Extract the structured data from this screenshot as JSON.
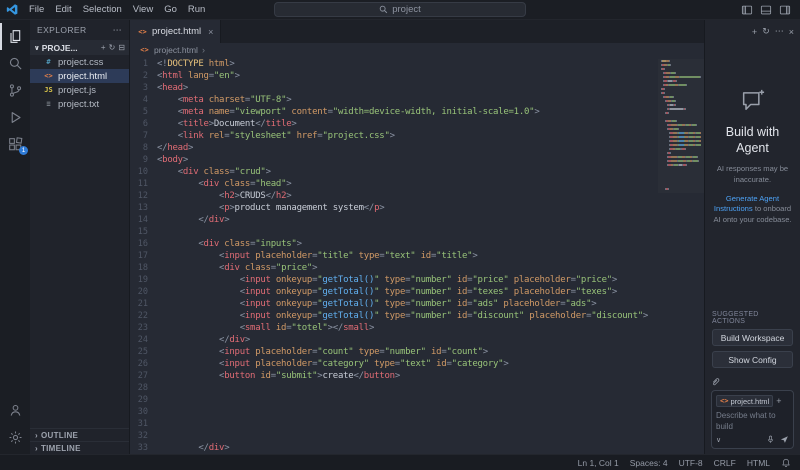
{
  "titlebar": {
    "menus": [
      "File",
      "Edit",
      "Selection",
      "View",
      "Go",
      "Run"
    ],
    "search_text": "project"
  },
  "activity": {
    "extensions_badge": "1"
  },
  "sidebar": {
    "title": "EXPLORER",
    "folder_name": "PROJE...",
    "files": [
      {
        "name": "project.css",
        "type": "css",
        "glyph": "#",
        "color": "#519aba",
        "selected": false
      },
      {
        "name": "project.html",
        "type": "html",
        "glyph": "<>",
        "color": "#e8824a",
        "selected": true
      },
      {
        "name": "project.js",
        "type": "js",
        "glyph": "JS",
        "color": "#d8c44a",
        "selected": false
      },
      {
        "name": "project.txt",
        "type": "txt",
        "glyph": "≡",
        "color": "#8a9199",
        "selected": false
      }
    ],
    "outline_label": "OUTLINE",
    "timeline_label": "TIMELINE"
  },
  "editor": {
    "tab_name": "project.html",
    "breadcrumb": "project.html",
    "syntax_colors": {
      "t": "#e06c75",
      "a": "#d19a66",
      "s": "#98c379",
      "p": "#8b93a3",
      "x": "#c7ccd6",
      "j": "#61afef",
      "d": "#e5c07b",
      "w": "transparent"
    },
    "lines": [
      [
        [
          "p",
          "<!"
        ],
        [
          "d",
          "DOCTYPE"
        ],
        [
          "a",
          " html"
        ],
        [
          "p",
          ">"
        ]
      ],
      [
        [
          "p",
          "<"
        ],
        [
          "t",
          "html"
        ],
        [
          "a",
          " lang"
        ],
        [
          "p",
          "="
        ],
        [
          "s",
          "\"en\""
        ],
        [
          "p",
          ">"
        ]
      ],
      [
        [
          "p",
          "<"
        ],
        [
          "t",
          "head"
        ],
        [
          "p",
          ">"
        ]
      ],
      [
        [
          "w",
          "    "
        ],
        [
          "p",
          "<"
        ],
        [
          "t",
          "meta"
        ],
        [
          "a",
          " charset"
        ],
        [
          "p",
          "="
        ],
        [
          "s",
          "\"UTF-8\""
        ],
        [
          "p",
          ">"
        ]
      ],
      [
        [
          "w",
          "    "
        ],
        [
          "p",
          "<"
        ],
        [
          "t",
          "meta"
        ],
        [
          "a",
          " name"
        ],
        [
          "p",
          "="
        ],
        [
          "s",
          "\"viewport\""
        ],
        [
          "a",
          " content"
        ],
        [
          "p",
          "="
        ],
        [
          "s",
          "\"width=device-width, initial-scale=1.0\""
        ],
        [
          "p",
          ">"
        ]
      ],
      [
        [
          "w",
          "    "
        ],
        [
          "p",
          "<"
        ],
        [
          "t",
          "title"
        ],
        [
          "p",
          ">"
        ],
        [
          "x",
          "Document"
        ],
        [
          "p",
          "</"
        ],
        [
          "t",
          "title"
        ],
        [
          "p",
          ">"
        ]
      ],
      [
        [
          "w",
          "    "
        ],
        [
          "p",
          "<"
        ],
        [
          "t",
          "link"
        ],
        [
          "a",
          " rel"
        ],
        [
          "p",
          "="
        ],
        [
          "s",
          "\"stylesheet\""
        ],
        [
          "a",
          " href"
        ],
        [
          "p",
          "="
        ],
        [
          "s",
          "\"project.css\""
        ],
        [
          "p",
          ">"
        ]
      ],
      [
        [
          "p",
          "</"
        ],
        [
          "t",
          "head"
        ],
        [
          "p",
          ">"
        ]
      ],
      [
        [
          "p",
          "<"
        ],
        [
          "t",
          "body"
        ],
        [
          "p",
          ">"
        ]
      ],
      [
        [
          "w",
          "    "
        ],
        [
          "p",
          "<"
        ],
        [
          "t",
          "div"
        ],
        [
          "a",
          " class"
        ],
        [
          "p",
          "="
        ],
        [
          "s",
          "\"crud\""
        ],
        [
          "p",
          ">"
        ]
      ],
      [
        [
          "w",
          "        "
        ],
        [
          "p",
          "<"
        ],
        [
          "t",
          "div"
        ],
        [
          "a",
          " class"
        ],
        [
          "p",
          "="
        ],
        [
          "s",
          "\"head\""
        ],
        [
          "p",
          ">"
        ]
      ],
      [
        [
          "w",
          "            "
        ],
        [
          "p",
          "<"
        ],
        [
          "t",
          "h2"
        ],
        [
          "p",
          ">"
        ],
        [
          "x",
          "CRUDS"
        ],
        [
          "p",
          "</"
        ],
        [
          "t",
          "h2"
        ],
        [
          "p",
          ">"
        ]
      ],
      [
        [
          "w",
          "            "
        ],
        [
          "p",
          "<"
        ],
        [
          "t",
          "p"
        ],
        [
          "p",
          ">"
        ],
        [
          "x",
          "product management system"
        ],
        [
          "p",
          "</"
        ],
        [
          "t",
          "p"
        ],
        [
          "p",
          ">"
        ]
      ],
      [
        [
          "w",
          "        "
        ],
        [
          "p",
          "</"
        ],
        [
          "t",
          "div"
        ],
        [
          "p",
          ">"
        ]
      ],
      [],
      [
        [
          "w",
          "        "
        ],
        [
          "p",
          "<"
        ],
        [
          "t",
          "div"
        ],
        [
          "a",
          " class"
        ],
        [
          "p",
          "="
        ],
        [
          "s",
          "\"inputs\""
        ],
        [
          "p",
          ">"
        ]
      ],
      [
        [
          "w",
          "            "
        ],
        [
          "p",
          "<"
        ],
        [
          "t",
          "input"
        ],
        [
          "a",
          " placeholder"
        ],
        [
          "p",
          "="
        ],
        [
          "s",
          "\"title\""
        ],
        [
          "a",
          " type"
        ],
        [
          "p",
          "="
        ],
        [
          "s",
          "\"text\""
        ],
        [
          "a",
          " id"
        ],
        [
          "p",
          "="
        ],
        [
          "s",
          "\"title\""
        ],
        [
          "p",
          ">"
        ]
      ],
      [
        [
          "w",
          "            "
        ],
        [
          "p",
          "<"
        ],
        [
          "t",
          "div"
        ],
        [
          "a",
          " class"
        ],
        [
          "p",
          "="
        ],
        [
          "s",
          "\"price\""
        ],
        [
          "p",
          ">"
        ]
      ],
      [
        [
          "w",
          "                "
        ],
        [
          "p",
          "<"
        ],
        [
          "t",
          "input"
        ],
        [
          "a",
          " onkeyup"
        ],
        [
          "p",
          "="
        ],
        [
          "s",
          "\""
        ],
        [
          "j",
          "getTotal()"
        ],
        [
          "s",
          "\""
        ],
        [
          "a",
          " type"
        ],
        [
          "p",
          "="
        ],
        [
          "s",
          "\"number\""
        ],
        [
          "a",
          " id"
        ],
        [
          "p",
          "="
        ],
        [
          "s",
          "\"price\""
        ],
        [
          "a",
          " placeholder"
        ],
        [
          "p",
          "="
        ],
        [
          "s",
          "\"price\""
        ],
        [
          "p",
          ">"
        ]
      ],
      [
        [
          "w",
          "                "
        ],
        [
          "p",
          "<"
        ],
        [
          "t",
          "input"
        ],
        [
          "a",
          " onkeyup"
        ],
        [
          "p",
          "="
        ],
        [
          "s",
          "\""
        ],
        [
          "j",
          "getTotal()"
        ],
        [
          "s",
          "\""
        ],
        [
          "a",
          " type"
        ],
        [
          "p",
          "="
        ],
        [
          "s",
          "\"number\""
        ],
        [
          "a",
          " id"
        ],
        [
          "p",
          "="
        ],
        [
          "s",
          "\"texes\""
        ],
        [
          "a",
          " placeholder"
        ],
        [
          "p",
          "="
        ],
        [
          "s",
          "\"texes\""
        ],
        [
          "p",
          ">"
        ]
      ],
      [
        [
          "w",
          "                "
        ],
        [
          "p",
          "<"
        ],
        [
          "t",
          "input"
        ],
        [
          "a",
          " onkeyup"
        ],
        [
          "p",
          "="
        ],
        [
          "s",
          "\""
        ],
        [
          "j",
          "getTotal()"
        ],
        [
          "s",
          "\""
        ],
        [
          "a",
          " type"
        ],
        [
          "p",
          "="
        ],
        [
          "s",
          "\"number\""
        ],
        [
          "a",
          " id"
        ],
        [
          "p",
          "="
        ],
        [
          "s",
          "\"ads\""
        ],
        [
          "a",
          " placeholder"
        ],
        [
          "p",
          "="
        ],
        [
          "s",
          "\"ads\""
        ],
        [
          "p",
          ">"
        ]
      ],
      [
        [
          "w",
          "                "
        ],
        [
          "p",
          "<"
        ],
        [
          "t",
          "input"
        ],
        [
          "a",
          " onkeyup"
        ],
        [
          "p",
          "="
        ],
        [
          "s",
          "\""
        ],
        [
          "j",
          "getTotal()"
        ],
        [
          "s",
          "\""
        ],
        [
          "a",
          " type"
        ],
        [
          "p",
          "="
        ],
        [
          "s",
          "\"number\""
        ],
        [
          "a",
          " id"
        ],
        [
          "p",
          "="
        ],
        [
          "s",
          "\"discount\""
        ],
        [
          "a",
          " placeholder"
        ],
        [
          "p",
          "="
        ],
        [
          "s",
          "\"discount\""
        ],
        [
          "p",
          ">"
        ]
      ],
      [
        [
          "w",
          "                "
        ],
        [
          "p",
          "<"
        ],
        [
          "t",
          "small"
        ],
        [
          "a",
          " id"
        ],
        [
          "p",
          "="
        ],
        [
          "s",
          "\"totel\""
        ],
        [
          "p",
          "></"
        ],
        [
          "t",
          "small"
        ],
        [
          "p",
          ">"
        ]
      ],
      [
        [
          "w",
          "            "
        ],
        [
          "p",
          "</"
        ],
        [
          "t",
          "div"
        ],
        [
          "p",
          ">"
        ]
      ],
      [
        [
          "w",
          "            "
        ],
        [
          "p",
          "<"
        ],
        [
          "t",
          "input"
        ],
        [
          "a",
          " placeholder"
        ],
        [
          "p",
          "="
        ],
        [
          "s",
          "\"count\""
        ],
        [
          "a",
          " type"
        ],
        [
          "p",
          "="
        ],
        [
          "s",
          "\"number\""
        ],
        [
          "a",
          " id"
        ],
        [
          "p",
          "="
        ],
        [
          "s",
          "\"count\""
        ],
        [
          "p",
          ">"
        ]
      ],
      [
        [
          "w",
          "            "
        ],
        [
          "p",
          "<"
        ],
        [
          "t",
          "input"
        ],
        [
          "a",
          " placeholder"
        ],
        [
          "p",
          "="
        ],
        [
          "s",
          "\"category\""
        ],
        [
          "a",
          " type"
        ],
        [
          "p",
          "="
        ],
        [
          "s",
          "\"text\""
        ],
        [
          "a",
          " id"
        ],
        [
          "p",
          "="
        ],
        [
          "s",
          "\"category\""
        ],
        [
          "p",
          ">"
        ]
      ],
      [
        [
          "w",
          "            "
        ],
        [
          "p",
          "<"
        ],
        [
          "t",
          "button"
        ],
        [
          "a",
          " id"
        ],
        [
          "p",
          "="
        ],
        [
          "s",
          "\"submit\""
        ],
        [
          "p",
          ">"
        ],
        [
          "x",
          "create"
        ],
        [
          "p",
          "</"
        ],
        [
          "t",
          "button"
        ],
        [
          "p",
          ">"
        ]
      ],
      [],
      [],
      [],
      [],
      [],
      [
        [
          "w",
          "        "
        ],
        [
          "p",
          "</"
        ],
        [
          "t",
          "div"
        ],
        [
          "p",
          ">"
        ]
      ]
    ]
  },
  "agent": {
    "title": "Build with Agent",
    "note": "AI responses may be inaccurate.",
    "link": "Generate Agent Instructions",
    "link_tail": "to onboard AI onto your codebase.",
    "suggested_label": "SUGGESTED ACTIONS",
    "action_build": "Build Workspace",
    "action_config": "Show Config",
    "context_chip": "project.html",
    "input_placeholder": "Describe what to build"
  },
  "status": {
    "items": [
      {
        "name": "cursor-position",
        "label": "Ln 1, Col 1"
      },
      {
        "name": "indentation",
        "label": "Spaces: 4"
      },
      {
        "name": "encoding",
        "label": "UTF-8"
      },
      {
        "name": "eol-sequence",
        "label": "CRLF"
      },
      {
        "name": "language-mode",
        "label": "HTML"
      }
    ]
  }
}
